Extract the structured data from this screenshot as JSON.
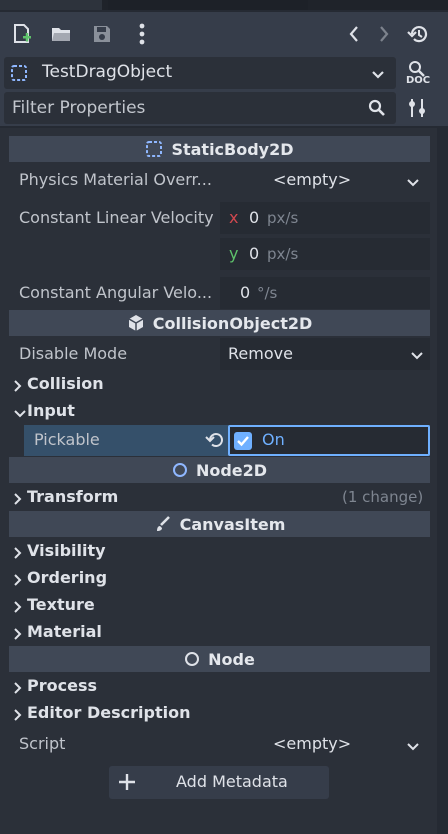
{
  "toolbar": {
    "icons": [
      "new-resource-icon",
      "open-folder-icon",
      "save-icon",
      "more-icon",
      "back-icon",
      "forward-icon",
      "history-icon"
    ]
  },
  "node_selector": {
    "value": "TestDragObject",
    "doc_label": "DOC"
  },
  "filter": {
    "placeholder": "Filter Properties"
  },
  "categories": {
    "static_body": "StaticBody2D",
    "collision_object": "CollisionObject2D",
    "node2d": "Node2D",
    "canvas_item": "CanvasItem",
    "node": "Node"
  },
  "static_body": {
    "physics_material_label": "Physics Material Overr...",
    "physics_material_value": "<empty>",
    "linear_velocity_label": "Constant Linear Velocity",
    "linear_x_axis": "x",
    "linear_x_value": "0",
    "linear_y_axis": "y",
    "linear_y_value": "0",
    "linear_unit": "px/s",
    "angular_velocity_label": "Constant Angular Velo...",
    "angular_value": "0",
    "angular_unit": "°/s"
  },
  "collision_object": {
    "disable_mode_label": "Disable Mode",
    "disable_mode_value": "Remove",
    "collision_section": "Collision",
    "input_section": "Input",
    "pickable_label": "Pickable",
    "pickable_value": "On",
    "pickable_checked": true
  },
  "node2d": {
    "transform_section": "Transform",
    "transform_changes": "(1 change)"
  },
  "canvas_item": {
    "sections": [
      "Visibility",
      "Ordering",
      "Texture",
      "Material"
    ]
  },
  "node": {
    "sections": [
      "Process",
      "Editor Description"
    ],
    "script_label": "Script",
    "script_value": "<empty>",
    "add_metadata_label": "Add Metadata"
  },
  "colors": {
    "accent": "#6fb0ff",
    "axis_x": "#d0484f",
    "axis_y": "#5ec26b",
    "header_bg": "#404856",
    "panel_bg": "#2b3039"
  }
}
